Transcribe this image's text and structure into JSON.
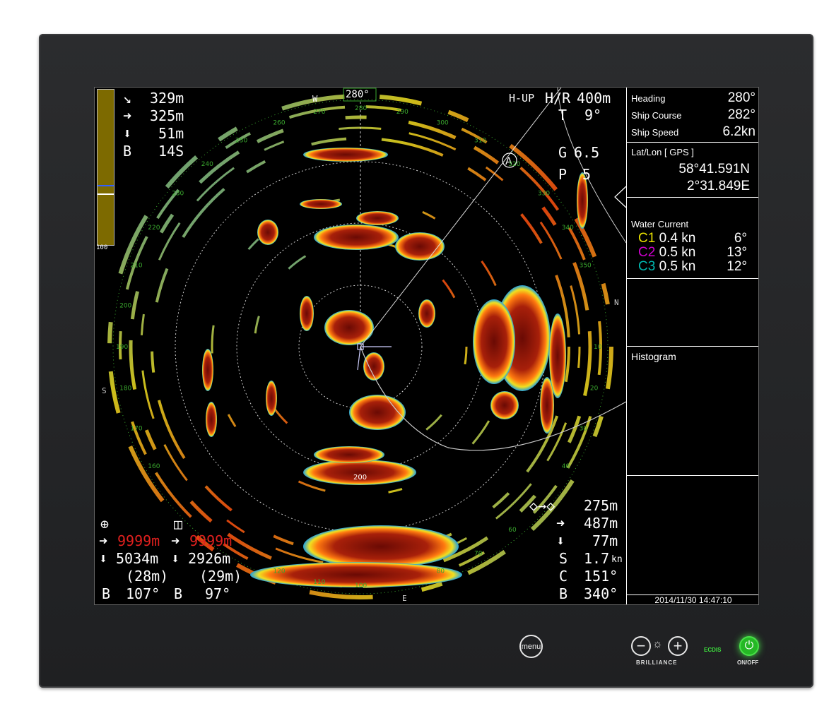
{
  "top_left": {
    "r1": "329m",
    "r2": "325m",
    "r3": " 51m",
    "bearing_lbl": "B",
    "bearing_val": "14S",
    "scale_pct": "100"
  },
  "top_center": {
    "compass_w": "W",
    "heading_box": "280°"
  },
  "top_right": {
    "mode": "H-UP",
    "hr_lbl": "H/R",
    "range": "400m",
    "t_lbl": "T",
    "t_val": "9°",
    "g_lbl": "G",
    "g_val": "6.5",
    "p_lbl": "P",
    "p_val": "5"
  },
  "bearing_ticks": [
    "250",
    "260",
    "270",
    "280",
    "290",
    "300",
    "310",
    "320",
    "330",
    "340",
    "350",
    "10",
    "20",
    "30",
    "40",
    "60",
    "70",
    "80",
    "100",
    "110",
    "120",
    "160",
    "170",
    "180",
    "190",
    "200",
    "210",
    "220",
    "230",
    "240"
  ],
  "cardinals": {
    "n": "N",
    "s": "S",
    "e": "E",
    "w": "W"
  },
  "ring_label": "200",
  "marker_a": "A",
  "bottom_left": {
    "m1_r": "9999m",
    "m1_d": "5034m",
    "m1_p": "(28m)",
    "m1_b_lbl": "B",
    "m1_b": "107°",
    "m2_r": "9999m",
    "m2_d": "2926m",
    "m2_p": "(29m)",
    "m2_b_lbl": "B",
    "m2_b": "97°"
  },
  "bottom_right": {
    "v1": "275m",
    "v2": "487m",
    "v3": " 77m",
    "s_lbl": "S",
    "s_val": "1.7",
    "s_unit": "kn",
    "c_lbl": "C",
    "c_val": "151°",
    "b_lbl": "B",
    "b_val": "340°"
  },
  "panel": {
    "heading_lbl": "Heading",
    "heading_val": "280°",
    "course_lbl": "Ship Course",
    "course_val": "282°",
    "speed_lbl": "Ship Speed",
    "speed_val": "6.2kn",
    "latlon_lbl": "Lat/Lon [ GPS ]",
    "lat": "58°41.591N",
    "lon": "2°31.849E",
    "current_lbl": "Water Current",
    "currents": [
      {
        "id": "C1",
        "speed": "0.4 kn",
        "dir": "6°",
        "color": "#e8e000"
      },
      {
        "id": "C2",
        "speed": "0.5 kn",
        "dir": "13°",
        "color": "#d000d0"
      },
      {
        "id": "C3",
        "speed": "0.5 kn",
        "dir": "12°",
        "color": "#00b8b0"
      }
    ],
    "histogram_lbl": "Histogram",
    "datetime": "2014/11/30 14:47:10"
  },
  "controls": {
    "menu": "menu",
    "brilliance": "BRILLIANCE",
    "ecdis": "ECDIS",
    "onoff": "ON/OFF"
  },
  "colors": {
    "echo_strong": "#7a0d05",
    "echo_mid": "#e03a10",
    "echo_edge_yellow": "#f0e020",
    "echo_edge_cyan": "#20b0e0",
    "grid_green": "#3aa82e",
    "bar_olive": "#7d6a00"
  }
}
